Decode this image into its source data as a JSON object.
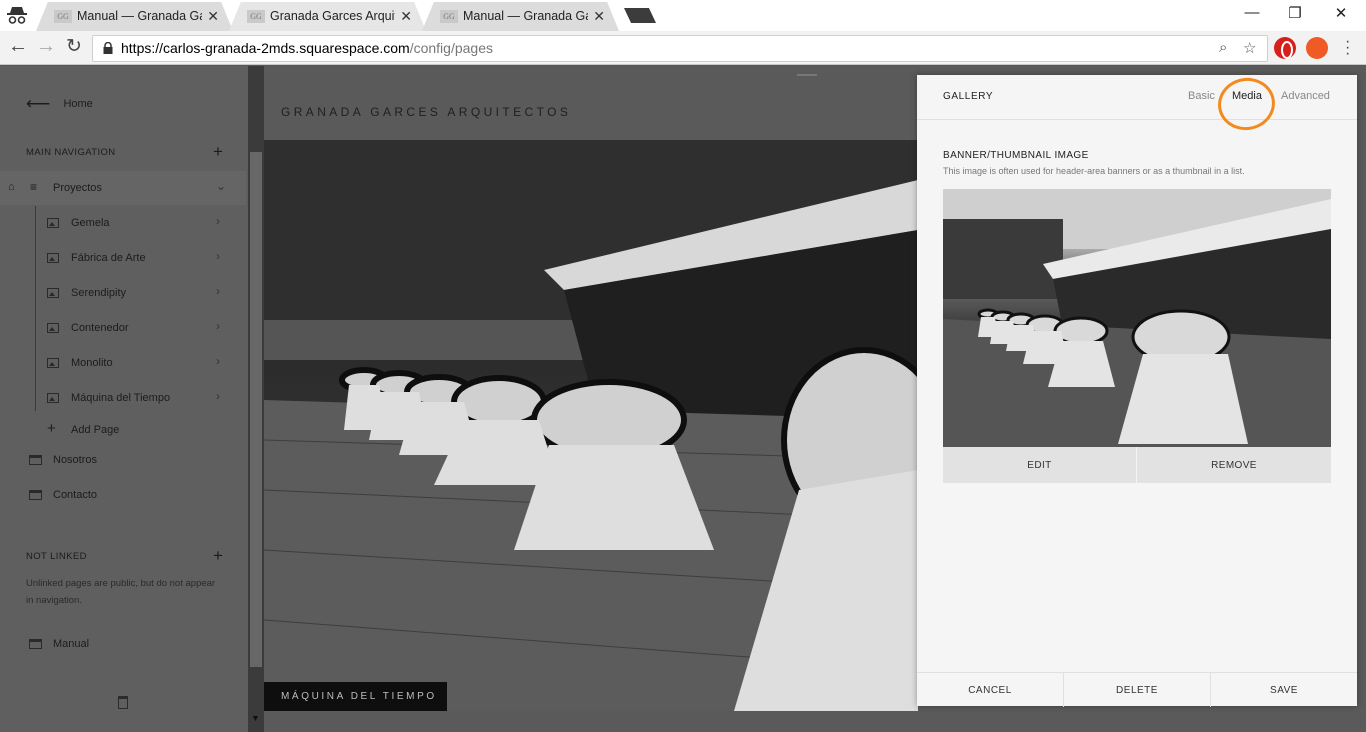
{
  "browser": {
    "tabs": [
      {
        "favicon": "GG",
        "title": "Manual — Granada Garc",
        "active": false
      },
      {
        "favicon": "GG",
        "title": "Granada Garces Arquitec",
        "active": true
      },
      {
        "favicon": "GG",
        "title": "Manual — Granada Garc",
        "active": false
      }
    ],
    "url_main": "https://carlos-granada-2mds.squarespace.com",
    "url_path": "/config/pages"
  },
  "sidebar": {
    "home_label": "Home",
    "main_nav_label": "MAIN NAVIGATION",
    "folder_label": "Proyectos",
    "pages": [
      "Gemela",
      "Fábrica de Arte",
      "Serendipity",
      "Contenedor",
      "Monolito",
      "Máquina del Tiempo"
    ],
    "add_page_label": "Add Page",
    "top_pages": [
      "Nosotros",
      "Contacto"
    ],
    "not_linked_label": "NOT LINKED",
    "not_linked_note": "Unlinked pages are public, but do not appear in navigation.",
    "unlinked_pages": [
      "Manual"
    ]
  },
  "preview": {
    "site_title": "GRANADA GARCES ARQUITECTOS",
    "caption": "MÁQUINA DEL TIEMPO"
  },
  "panel": {
    "title": "GALLERY",
    "tabs": [
      {
        "label": "Basic",
        "active": false
      },
      {
        "label": "Media",
        "active": true
      },
      {
        "label": "Advanced",
        "active": false
      }
    ],
    "field_label": "BANNER/THUMBNAIL IMAGE",
    "field_description": "This image is often used for header-area banners or as a thumbnail in a list.",
    "edit_label": "EDIT",
    "remove_label": "REMOVE",
    "cancel_label": "CANCEL",
    "delete_label": "DELETE",
    "save_label": "SAVE"
  },
  "colors": {
    "annotation_circle": "#f28a1e",
    "opera_red": "#d6201c",
    "panel_bg": "#f5f5f5"
  },
  "icons": [
    "incognito-icon",
    "close-icon",
    "back-icon",
    "forward-icon",
    "reload-icon",
    "lock-icon",
    "zoom-icon",
    "star-icon",
    "opera-extension-icon",
    "fire-extension-icon",
    "menu-icon",
    "arrow-left-icon",
    "plus-icon",
    "home-icon",
    "hamburger-icon",
    "chevron-icon",
    "image-page-icon",
    "page-icon",
    "trash-icon"
  ]
}
